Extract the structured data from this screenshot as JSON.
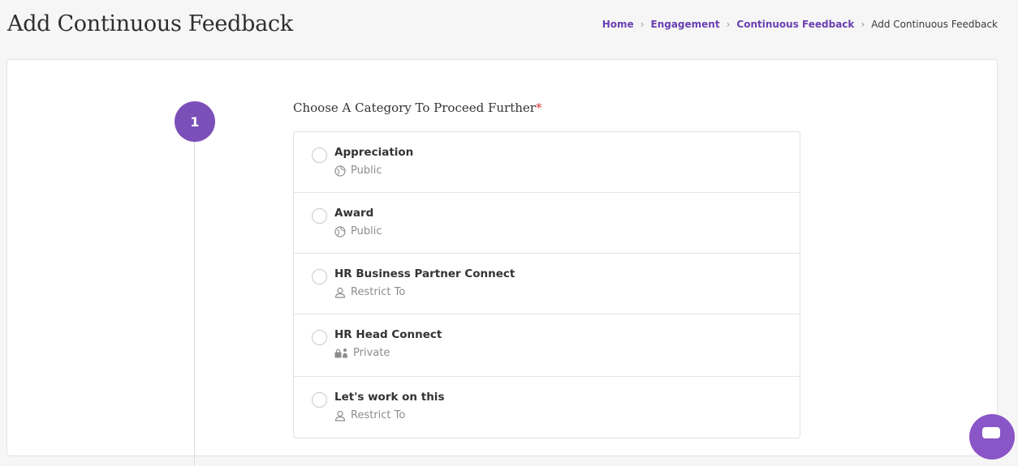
{
  "header": {
    "title": "Add Continuous Feedback",
    "breadcrumb": [
      {
        "label": "Home",
        "link": true
      },
      {
        "label": "Engagement",
        "link": true
      },
      {
        "label": "Continuous Feedback",
        "link": true
      },
      {
        "label": "Add Continuous Feedback",
        "link": false
      }
    ]
  },
  "step": {
    "number": "1",
    "label": "Choose A Category To Proceed Further",
    "required_mark": "*"
  },
  "categories": [
    {
      "title": "Appreciation",
      "visibility": "Public",
      "icon": "globe-icon"
    },
    {
      "title": "Award",
      "visibility": "Public",
      "icon": "globe-icon"
    },
    {
      "title": "HR Business Partner Connect",
      "visibility": "Restrict To",
      "icon": "user-icon"
    },
    {
      "title": "HR Head Connect",
      "visibility": "Private",
      "icon": "private-lock-icon"
    },
    {
      "title": "Let's work on this",
      "visibility": "Restrict To",
      "icon": "user-icon"
    }
  ],
  "colors": {
    "accent": "#7b4fb8",
    "link": "#6a3fb2",
    "required": "#d93434"
  }
}
